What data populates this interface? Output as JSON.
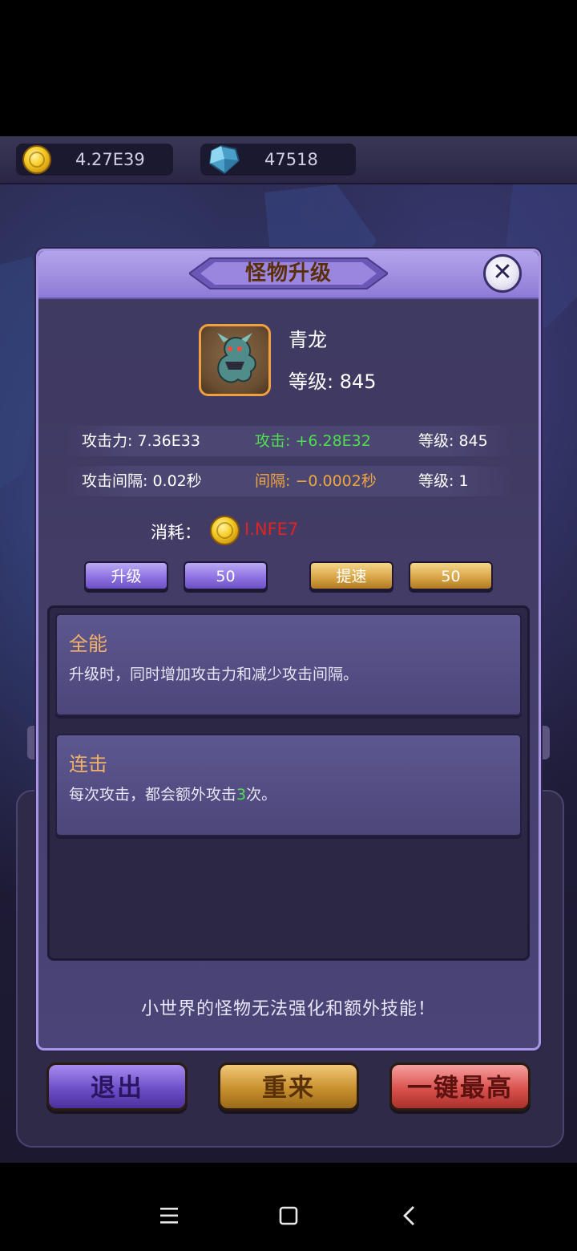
{
  "resources": {
    "gold": "4.27E39",
    "gems": "47518"
  },
  "dialog": {
    "title": "怪物升级",
    "close_glyph": "✕"
  },
  "monster": {
    "name": "青龙",
    "level": "等级: 845"
  },
  "stats": [
    {
      "label": "攻击力: 7.36E33",
      "delta": "攻击: +6.28E32",
      "level": "等级: 845"
    },
    {
      "label": "攻击间隔: 0.02秒",
      "delta": "间隔: −0.0002秒",
      "level": "等级: 1"
    }
  ],
  "cost": {
    "label": "消耗：",
    "value": "I.NFE7"
  },
  "actions": {
    "upgrade_label": "升级",
    "upgrade_amount": "50",
    "speedup_label": "提速",
    "speedup_amount": "50"
  },
  "skills": [
    {
      "title": "全能",
      "desc": "升级时，同时增加攻击力和减少攻击间隔。"
    },
    {
      "title": "连击",
      "desc_before": "每次攻击，都会额外攻击",
      "desc_number": "3",
      "desc_after": "次。"
    }
  ],
  "notice": "小世界的怪物无法强化和额外技能！",
  "bottom_buttons": {
    "exit": "退出",
    "retry": "重来",
    "max": "一键最高"
  },
  "colors": {
    "delta_attack": "#4fe04f",
    "delta_interval": "#f0a640",
    "cost_value": "#e02424",
    "skill_title": "#f4b266"
  },
  "icons": {
    "gold": "coin-icon",
    "gems": "diamond-icon",
    "close": "close-icon",
    "nav_menu": "menu-icon",
    "nav_home": "home-icon",
    "nav_back": "back-icon"
  }
}
